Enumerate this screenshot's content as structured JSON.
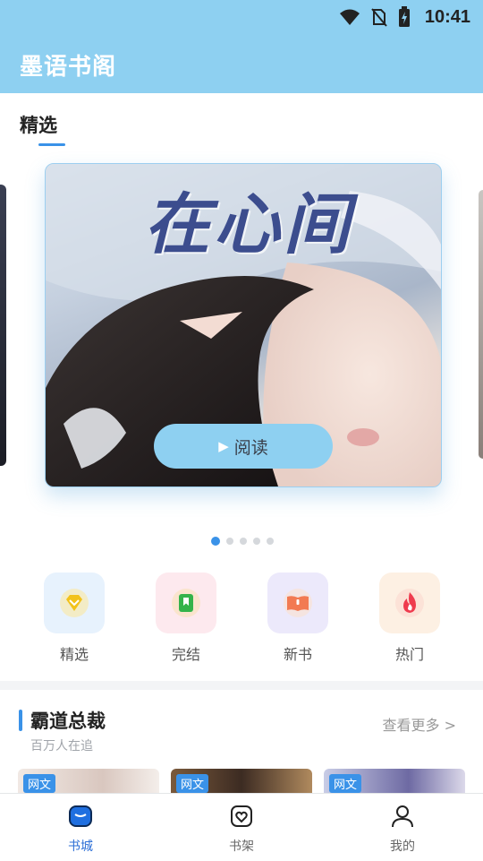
{
  "status_bar": {
    "time": "10:41"
  },
  "app": {
    "title": "墨语书阁"
  },
  "featured": {
    "section_title": "精选",
    "banner": {
      "title": "在心间",
      "read_label": "阅读"
    },
    "page_count": 5,
    "active_page": 1
  },
  "categories": [
    {
      "label": "精选",
      "icon": "diamond-icon",
      "bg": "#e7f2fd",
      "color": "#f2c21a"
    },
    {
      "label": "完结",
      "icon": "bookmark-icon",
      "bg": "#fde9ee",
      "color": "#34b34a"
    },
    {
      "label": "新书",
      "icon": "open-book-icon",
      "bg": "#ece9fb",
      "color": "#f27a52"
    },
    {
      "label": "热门",
      "icon": "fire-icon",
      "bg": "#fdf0e3",
      "color": "#ef3b4e"
    }
  ],
  "section": {
    "title": "霸道总裁",
    "subtitle": "百万人在追",
    "more": "查看更多 >",
    "books": [
      {
        "tag": "网文"
      },
      {
        "tag": "网文"
      },
      {
        "tag": "网文"
      }
    ]
  },
  "tabs": [
    {
      "label": "书城",
      "icon": "bookstore-icon",
      "active": true
    },
    {
      "label": "书架",
      "icon": "bookshelf-icon",
      "active": false
    },
    {
      "label": "我的",
      "icon": "profile-icon",
      "active": false
    }
  ],
  "colors": {
    "accent": "#3a92e8",
    "header": "#8ed0f1"
  }
}
